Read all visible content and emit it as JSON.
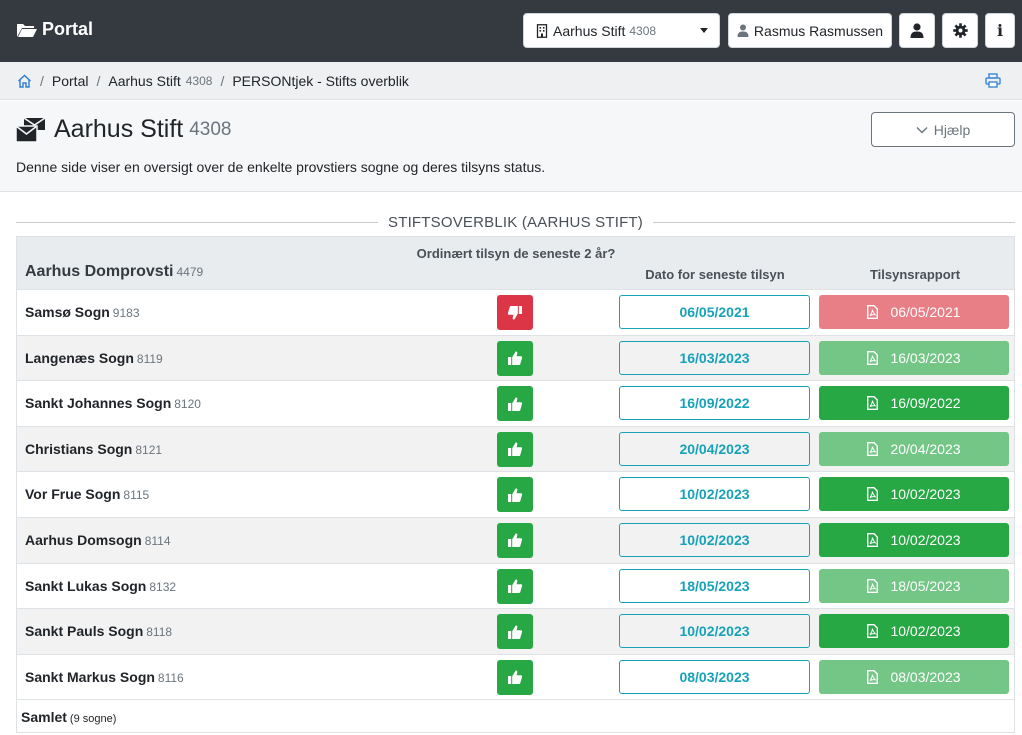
{
  "nav": {
    "brand": "Portal",
    "stift_name": "Aarhus Stift",
    "stift_number": "4308",
    "user_name": "Rasmus Rasmussen",
    "info_label": "i"
  },
  "breadcrumb": {
    "portal": "Portal",
    "stift": "Aarhus Stift",
    "stift_number": "4308",
    "current": "PERSONtjek - Stifts overblik"
  },
  "header": {
    "title": "Aarhus Stift",
    "number": "4308",
    "help_label": "Hjælp",
    "description": "Denne side viser en oversigt over de enkelte provstiers sogne og deres tilsyns status."
  },
  "section_title": "STIFTSOVERBLIK (AARHUS STIFT)",
  "table": {
    "provsti": "Aarhus Domprovsti",
    "provsti_number": "4479",
    "col_ordinaert": "Ordinært tilsyn de seneste 2 år?",
    "col_dato": "Dato for seneste tilsyn",
    "col_rapport": "Tilsynsrapport",
    "rows": [
      {
        "name": "Samsø Sogn",
        "number": "9183",
        "status": "no",
        "dato": "06/05/2021",
        "rapport": "06/05/2021",
        "rapport_style": "red"
      },
      {
        "name": "Langenæs Sogn",
        "number": "8119",
        "status": "ok",
        "dato": "16/03/2023",
        "rapport": "16/03/2023",
        "rapport_style": "light"
      },
      {
        "name": "Sankt Johannes Sogn",
        "number": "8120",
        "status": "ok",
        "dato": "16/09/2022",
        "rapport": "16/09/2022",
        "rapport_style": "green"
      },
      {
        "name": "Christians Sogn",
        "number": "8121",
        "status": "ok",
        "dato": "20/04/2023",
        "rapport": "20/04/2023",
        "rapport_style": "light"
      },
      {
        "name": "Vor Frue Sogn",
        "number": "8115",
        "status": "ok",
        "dato": "10/02/2023",
        "rapport": "10/02/2023",
        "rapport_style": "green"
      },
      {
        "name": "Aarhus Domsogn",
        "number": "8114",
        "status": "ok",
        "dato": "10/02/2023",
        "rapport": "10/02/2023",
        "rapport_style": "green"
      },
      {
        "name": "Sankt Lukas Sogn",
        "number": "8132",
        "status": "ok",
        "dato": "18/05/2023",
        "rapport": "18/05/2023",
        "rapport_style": "light"
      },
      {
        "name": "Sankt Pauls Sogn",
        "number": "8118",
        "status": "ok",
        "dato": "10/02/2023",
        "rapport": "10/02/2023",
        "rapport_style": "green"
      },
      {
        "name": "Sankt Markus Sogn",
        "number": "8116",
        "status": "ok",
        "dato": "08/03/2023",
        "rapport": "08/03/2023",
        "rapport_style": "light"
      }
    ],
    "footer_label": "Samlet",
    "footer_count": "(9 sogne)"
  },
  "colors": {
    "navbar": "#343a40",
    "success": "#28a745",
    "success_light": "#74c686",
    "danger": "#dc3545",
    "danger_light": "#e87f86",
    "info": "#17a2b8"
  },
  "icons": {
    "brand": "folder-open-icon",
    "stift": "building-icon",
    "user": "user-icon",
    "profile": "user-icon",
    "settings": "gear-icon",
    "info": "info-icon",
    "home": "home-icon",
    "print": "print-icon",
    "title": "envelopes-icon",
    "help": "chevron-down-icon",
    "status_ok": "thumbs-up-icon",
    "status_no": "thumbs-down-icon",
    "report": "file-pdf-icon"
  }
}
